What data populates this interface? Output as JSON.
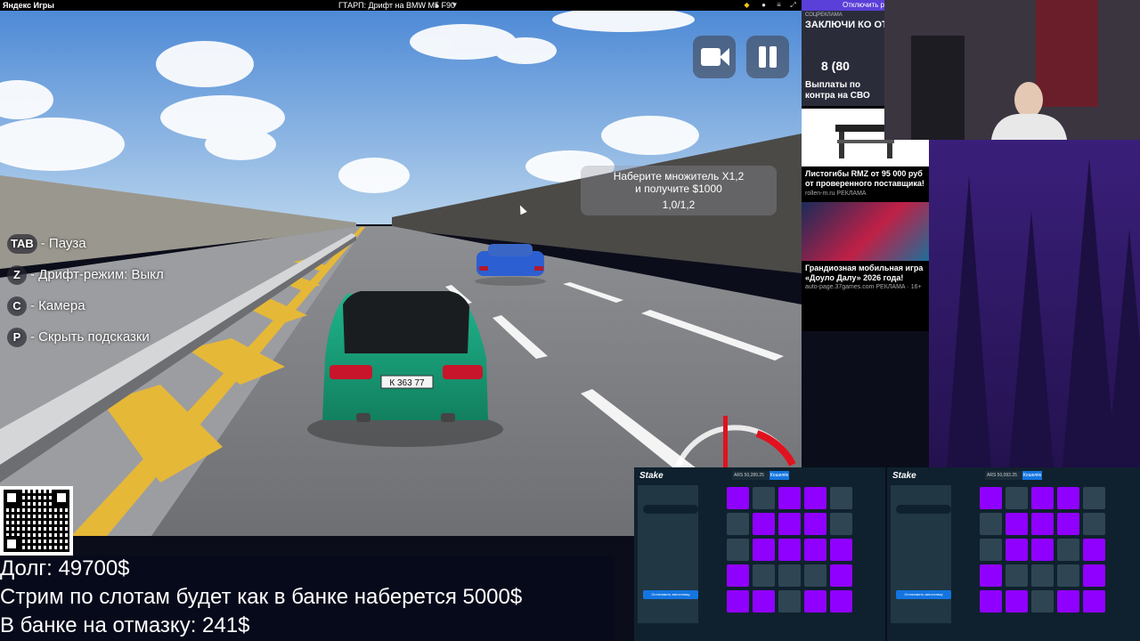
{
  "browser": {
    "brand": "Яндекс Игры",
    "game_title": "ГТАРП: Дрифт на BMW M5 F90",
    "disable_ads": "Отключить ре"
  },
  "game": {
    "mission_line1": "Наберите множитель X1,2",
    "mission_line2": "и получите $1000",
    "mission_progress": "1,0/1,2",
    "hints": [
      {
        "key": "TAB",
        "label": "- Пауза"
      },
      {
        "key": "Z",
        "label": "- Дрифт-режим: Выкл"
      },
      {
        "key": "C",
        "label": "- Камера"
      },
      {
        "key": "P",
        "label": "- Скрыть подсказки"
      }
    ],
    "plate": "К 363 77"
  },
  "ads": {
    "top_label": "СОЦРЕКЛАМА",
    "top_head": "ЗАКЛЮЧИ КО ОТ САНКТ-ПЕТ ИЗ ЛЮБОГО Р",
    "top_number": "8 (80",
    "top_caption": "Выплаты по контра на СВО",
    "ad2_caption": "Листогибы RMZ от 95 000 руб от проверенного поставщика!",
    "ad2_source": "rollen-m.ru",
    "ad2_tag": "РЕКЛАМА",
    "ad3_caption": "Грандиозная мобильная игра «Доуло Далу» 2026 года!",
    "ad3_source": "auto-page.37games.com",
    "ad3_tag": "РЕКЛАМА · 16+"
  },
  "stake": {
    "logo": "Stake",
    "balance_left": "ARS 50,289.25",
    "balance_right": "ARS 50,093.25",
    "wallet": "Кошелёк",
    "start_auto": "Остановить автоставку",
    "grid_left": [
      1,
      0,
      1,
      1,
      0,
      0,
      1,
      1,
      1,
      0,
      0,
      1,
      1,
      1,
      1,
      1,
      0,
      0,
      0,
      1,
      1,
      1,
      0,
      1,
      1
    ],
    "grid_right": [
      1,
      0,
      1,
      1,
      0,
      0,
      1,
      1,
      1,
      0,
      0,
      1,
      1,
      0,
      1,
      1,
      0,
      0,
      0,
      1,
      1,
      1,
      0,
      1,
      1
    ]
  },
  "stream": {
    "debt": "Долг: 49700$",
    "slots": "Стрим по слотам будет как в банке наберется 5000$",
    "bank": "В банке на отмазку: 241$"
  },
  "colors": {
    "car": "#1aa37f",
    "sky_top": "#4e8ad6",
    "mines_gem": "#9000ff",
    "stake_bg": "#0f212e"
  }
}
